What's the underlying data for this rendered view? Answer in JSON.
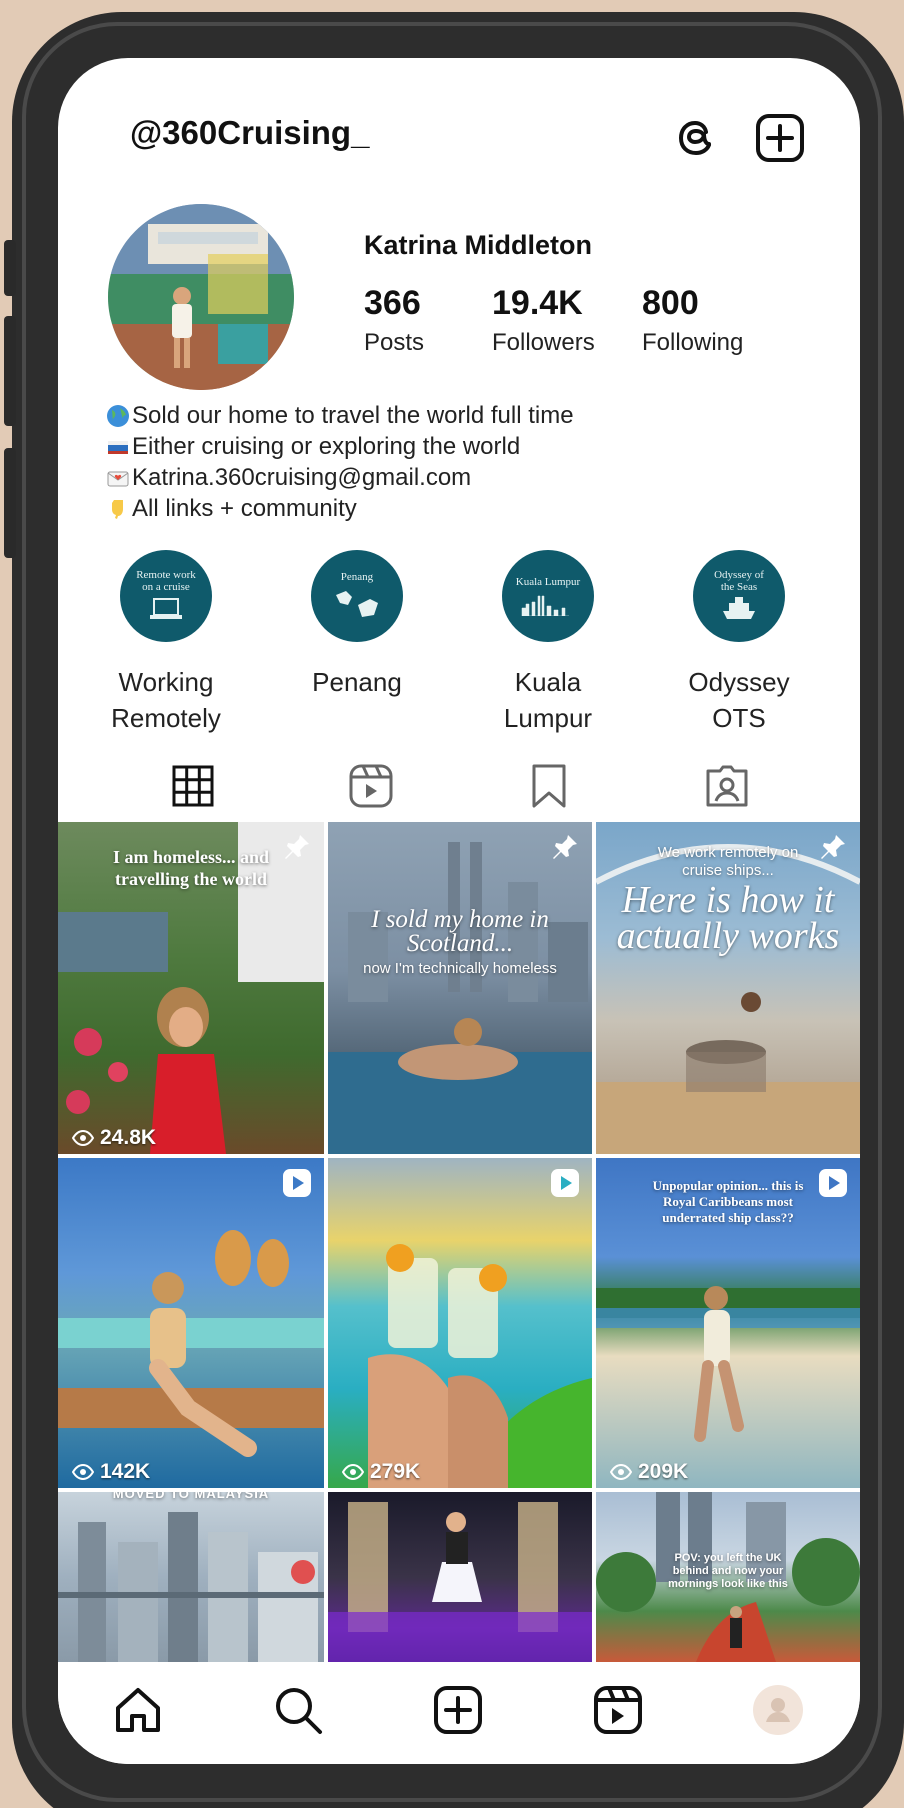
{
  "profile": {
    "username": "@360Cruising_",
    "display_name": "Katrina Middleton",
    "stats": [
      {
        "value": "366",
        "label": "Posts"
      },
      {
        "value": "19.4K",
        "label": "Followers"
      },
      {
        "value": "800",
        "label": "Following"
      }
    ],
    "bio": [
      {
        "icon": "globe-emoji",
        "text": "Sold our home to travel the world full time"
      },
      {
        "icon": "ship-emoji",
        "text": "Either cruising or exploring the world"
      },
      {
        "icon": "love-letter-emoji",
        "text": "Katrina.360cruising@gmail.com"
      },
      {
        "icon": "pointing-down-emoji",
        "text": "All links + community"
      }
    ]
  },
  "highlights": [
    {
      "cover_text": "Remote work on a cruise",
      "label_line1": "Working",
      "label_line2": "Remotely",
      "icon": "laptop-icon"
    },
    {
      "cover_text": "Penang",
      "label_line1": "Penang",
      "label_line2": "",
      "icon": "map-icon"
    },
    {
      "cover_text": "Kuala Lumpur",
      "label_line1": "Kuala",
      "label_line2": "Lumpur",
      "icon": "skyline-icon"
    },
    {
      "cover_text": "Odyssey of the Seas",
      "label_line1": "Odyssey",
      "label_line2": "OTS",
      "icon": "ship-icon"
    }
  ],
  "tabs": [
    "grid-icon",
    "reels-icon",
    "saved-icon",
    "tagged-icon"
  ],
  "posts": [
    {
      "caption": "I am homeless... and travelling the world",
      "views": "24.8K",
      "badge": "pin-icon"
    },
    {
      "caption": "I sold my home in Scotland...",
      "subcaption": "now I'm technically homeless",
      "views": "",
      "badge": "pin-icon"
    },
    {
      "caption_small": "We work remotely on cruise ships...",
      "caption": "Here is how it actually works",
      "views": "",
      "badge": "pin-icon"
    },
    {
      "caption": "",
      "views": "142K",
      "badge": "reel-icon"
    },
    {
      "caption": "",
      "views": "279K",
      "badge": "reel-icon"
    },
    {
      "caption": "Unpopular opinion... this is Royal Caribbeans most underrated ship class??",
      "views": "209K",
      "badge": "reel-icon"
    },
    {
      "caption": "MOVED TO MALAYSIA",
      "views": "",
      "badge": ""
    },
    {
      "caption": "",
      "views": "",
      "badge": ""
    },
    {
      "caption": "POV: you left the UK behind and now your mornings look like this",
      "views": "",
      "badge": ""
    }
  ],
  "bottom_nav": [
    "home-icon",
    "search-icon",
    "create-icon",
    "reels-icon",
    "profile-icon"
  ],
  "colors": {
    "background": "#e2cbb6",
    "highlight": "#0f5a6b",
    "phone": "#2d2d2d"
  }
}
